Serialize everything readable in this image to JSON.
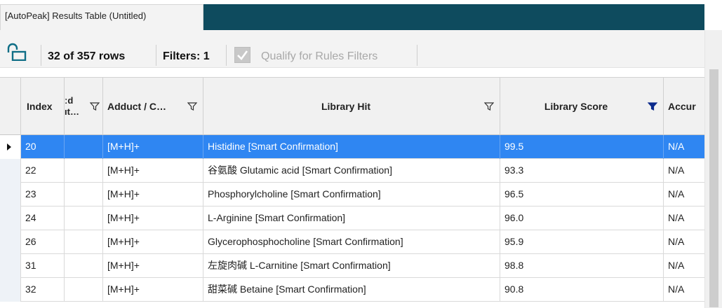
{
  "window": {
    "title": "[AutoPeak] Results Table (Untitled)",
    "accent_color": "#0e4b5e"
  },
  "toolbar": {
    "lock_icon": "unlock-icon",
    "rows_count": "32 of 357 rows",
    "filters_count": "Filters: 1",
    "qualify_label": "Qualify for Rules Filters",
    "qualify_checked": true
  },
  "table": {
    "columns": [
      {
        "label": "Index"
      },
      {
        "label_line1": "ːd",
        "label_line2": "ıt…"
      },
      {
        "label": "Adduct / C…"
      },
      {
        "label": "Library Hit"
      },
      {
        "label": "Library Score"
      },
      {
        "label": "Accur"
      }
    ],
    "rows": [
      {
        "index": "20",
        "adduct": "[M+H]+",
        "library_hit": "Histidine [Smart Confirmation]",
        "score": "99.5",
        "accuracy": "N/A",
        "selected": true
      },
      {
        "index": "22",
        "adduct": "[M+H]+",
        "library_hit": "谷氨酸 Glutamic acid [Smart Confirmation]",
        "score": "93.3",
        "accuracy": "N/A"
      },
      {
        "index": "23",
        "adduct": "[M+H]+",
        "library_hit": "Phosphorylcholine [Smart Confirmation]",
        "score": "96.5",
        "accuracy": "N/A"
      },
      {
        "index": "24",
        "adduct": "[M+H]+",
        "library_hit": "L-Arginine [Smart Confirmation]",
        "score": "96.0",
        "accuracy": "N/A"
      },
      {
        "index": "26",
        "adduct": "[M+H]+",
        "library_hit": "Glycerophosphocholine [Smart Confirmation]",
        "score": "95.9",
        "accuracy": "N/A"
      },
      {
        "index": "31",
        "adduct": "[M+H]+",
        "library_hit": "左旋肉碱 L-Carnitine [Smart Confirmation]",
        "score": "98.8",
        "accuracy": "N/A"
      },
      {
        "index": "32",
        "adduct": "[M+H]+",
        "library_hit": "甜菜碱 Betaine [Smart Confirmation]",
        "score": "90.8",
        "accuracy": "N/A"
      }
    ],
    "selected_row_color": "#2f86f2",
    "active_filter_color": "#0b2a8c"
  }
}
